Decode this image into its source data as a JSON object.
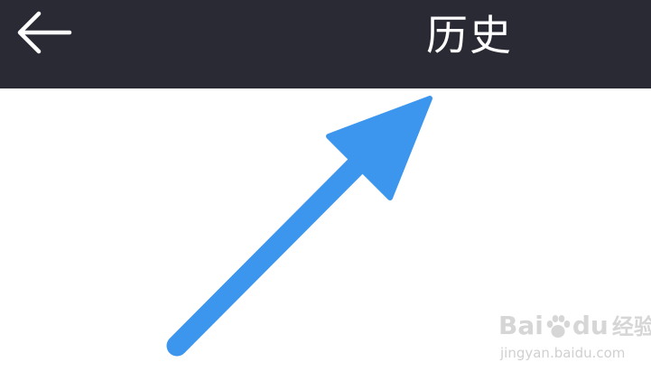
{
  "header": {
    "title": "历史",
    "back_icon": "back-arrow-icon",
    "background_color": "#2a2a35",
    "text_color": "#ffffff"
  },
  "annotation": {
    "icon": "pointer-arrow-icon",
    "color": "#3d96ee"
  },
  "watermark": {
    "brand_prefix": "Bai",
    "brand_suffix": "du",
    "brand_cn": "经验",
    "url": "jingyan.baidu.com"
  }
}
